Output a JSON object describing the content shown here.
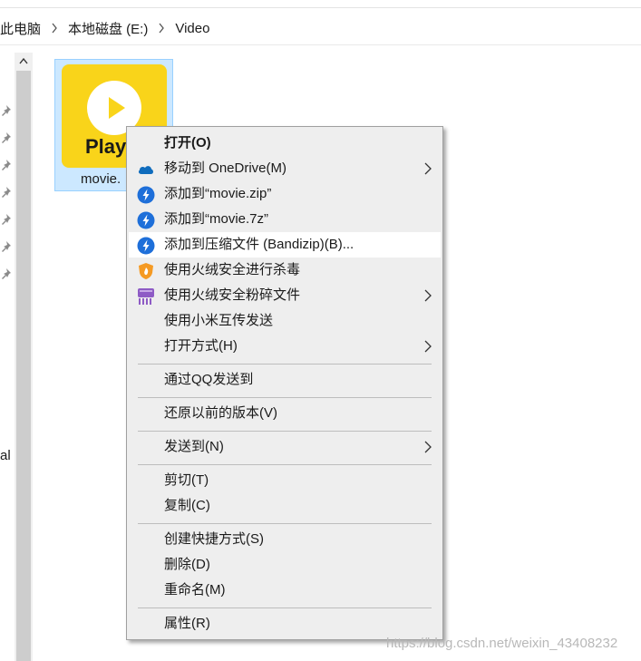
{
  "breadcrumb": {
    "items": [
      "此电脑",
      "本地磁盘 (E:)",
      "Video"
    ]
  },
  "nav_pane": {
    "partial_label": "al",
    "pinned_count": 7
  },
  "file": {
    "name": "movie.",
    "thumbnail_text": "Play",
    "thumb_color": "#f9d41a"
  },
  "context_menu": {
    "items": [
      {
        "label": "打开(O)",
        "icon": "none",
        "bold": true
      },
      {
        "label": "移动到 OneDrive(M)",
        "icon": "onedrive-cloud-icon",
        "submenu": true
      },
      {
        "label": "添加到“movie.zip”",
        "icon": "bandizip-icon"
      },
      {
        "label": "添加到“movie.7z”",
        "icon": "bandizip-icon"
      },
      {
        "label": "添加到压缩文件 (Bandizip)(B)...",
        "icon": "bandizip-icon",
        "highlighted": true
      },
      {
        "label": "使用火绒安全进行杀毒",
        "icon": "huorong-shield-icon"
      },
      {
        "label": "使用火绒安全粉碎文件",
        "icon": "huorong-shredder-icon",
        "submenu": true
      },
      {
        "label": "使用小米互传发送",
        "icon": "none"
      },
      {
        "label": "打开方式(H)",
        "icon": "none",
        "submenu": true
      },
      {
        "label": "通过QQ发送到",
        "icon": "none"
      },
      {
        "label": "还原以前的版本(V)",
        "icon": "none"
      },
      {
        "label": "发送到(N)",
        "icon": "none",
        "submenu": true
      },
      {
        "label": "剪切(T)",
        "icon": "none"
      },
      {
        "label": "复制(C)",
        "icon": "none"
      },
      {
        "label": "创建快捷方式(S)",
        "icon": "none"
      },
      {
        "label": "删除(D)",
        "icon": "none"
      },
      {
        "label": "重命名(M)",
        "icon": "none"
      },
      {
        "label": "属性(R)",
        "icon": "none"
      }
    ]
  },
  "watermark": "https://blog.csdn.net/weixin_43408232",
  "colors": {
    "bandizip_blue": "#1e6fd9",
    "onedrive_blue": "#0f6cbd",
    "huorong_orange": "#f59a23",
    "huorong_purple": "#8e5bc5",
    "selection": "#cce8ff"
  }
}
